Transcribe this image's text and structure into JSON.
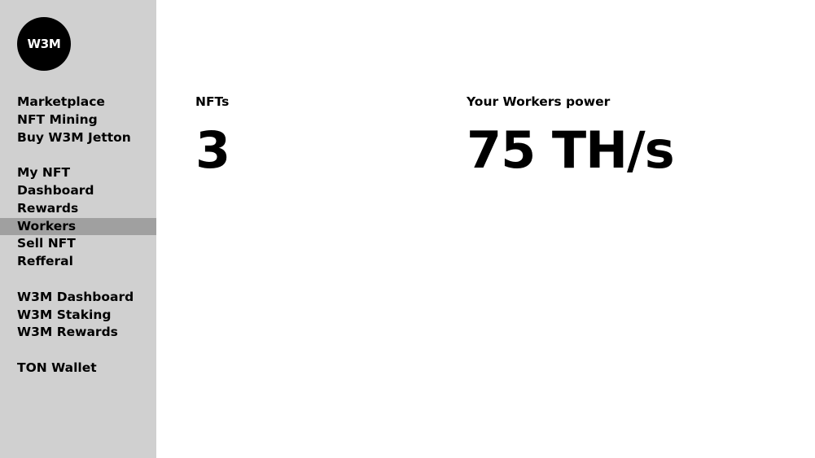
{
  "logo": {
    "text": "W3M"
  },
  "sidebar": {
    "groups": [
      {
        "items": [
          {
            "label": "Marketplace",
            "active": false
          },
          {
            "label": "NFT Mining",
            "active": false
          },
          {
            "label": "Buy W3M Jetton",
            "active": false
          }
        ]
      },
      {
        "items": [
          {
            "label": "My NFT",
            "active": false
          },
          {
            "label": "Dashboard",
            "active": false
          },
          {
            "label": "Rewards",
            "active": false
          },
          {
            "label": "Workers",
            "active": true
          },
          {
            "label": "Sell NFT",
            "active": false
          },
          {
            "label": "Refferal",
            "active": false
          }
        ]
      },
      {
        "items": [
          {
            "label": "W3M Dashboard",
            "active": false
          },
          {
            "label": "W3M Staking",
            "active": false
          },
          {
            "label": "W3M Rewards",
            "active": false
          }
        ]
      },
      {
        "items": [
          {
            "label": "TON Wallet",
            "active": false
          }
        ]
      }
    ]
  },
  "main": {
    "nfts": {
      "label": "NFTs",
      "value": "3"
    },
    "power": {
      "label": "Your Workers power",
      "value": "75 TH/s"
    }
  },
  "colors": {
    "sidebar_bg": "#d0d0d0",
    "active_item_bg": "#a0a0a0",
    "logo_bg": "#000000",
    "text": "#000000"
  }
}
